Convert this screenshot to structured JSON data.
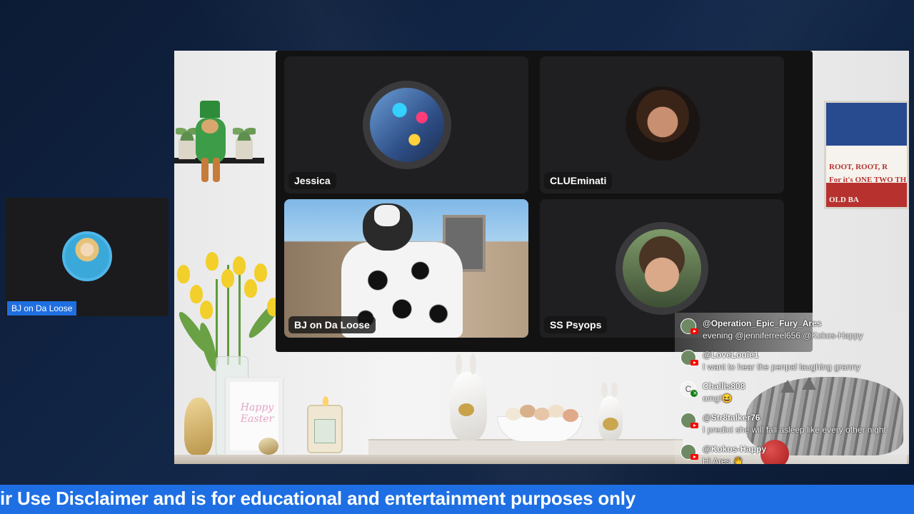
{
  "left_participant": {
    "name": "BJ on Da Loose",
    "avatar_icon": "profile-avatar"
  },
  "stage": {
    "card_text": "Happy Easter",
    "poster_lines": [
      "ROOT, ROOT, R",
      "For it's ONE TWO TH",
      "OLD BA"
    ]
  },
  "call_grid": {
    "participants": [
      {
        "name": "Jessica",
        "mode": "avatar"
      },
      {
        "name": "CLUEminati",
        "mode": "avatar"
      },
      {
        "name": "BJ on Da Loose",
        "mode": "video"
      },
      {
        "name": "SS Psyops",
        "mode": "avatar"
      }
    ]
  },
  "chat": {
    "messages": [
      {
        "user": "@Operation_Epic_Fury_Ares",
        "text": "evening @jenniferreel656 @Kokos-Happy",
        "platform": "youtube-icon"
      },
      {
        "user": "@LoveLouie1",
        "text": "I want to hear the penpal laughing granny",
        "platform": "youtube-icon"
      },
      {
        "user": "Challis808",
        "text": "omg!😆",
        "platform": "xbox-icon",
        "initial": "C"
      },
      {
        "user": "@Str8talker76",
        "text": "I predict she will fall asleep like every other night",
        "platform": "youtube-icon"
      },
      {
        "user": "@Kokos-Happy",
        "text": "Hi Ares 👋",
        "platform": "youtube-icon"
      }
    ]
  },
  "ticker": {
    "text": "ir Use Disclaimer and is for educational and entertainment purposes only"
  },
  "colors": {
    "ticker_bg": "#1e6fe3",
    "name_tag_bg": "#1f6fe0",
    "page_bg": "#0c1b35"
  }
}
